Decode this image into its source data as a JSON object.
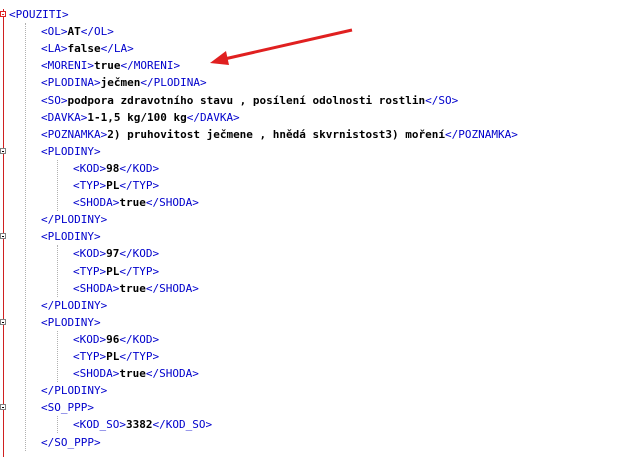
{
  "lines": [
    {
      "o": "<POUZITI>",
      "v": "",
      "c": ""
    },
    {
      "o": "<OL>",
      "v": "AT",
      "c": "</OL>"
    },
    {
      "o": "<LA>",
      "v": "false",
      "c": "</LA>"
    },
    {
      "o": "<MORENI>",
      "v": "true",
      "c": "</MORENI>"
    },
    {
      "o": "<PLODINA>",
      "v": "ječmen",
      "c": "</PLODINA>"
    },
    {
      "o": "<SO>",
      "v": "podpora zdravotního stavu , posílení odolnosti rostlin",
      "c": "</SO>"
    },
    {
      "o": "<DAVKA>",
      "v": "1-1,5 kg/100 kg",
      "c": "</DAVKA>"
    },
    {
      "o": "<POZNAMKA>",
      "v": "2) pruhovitost ječmene , hnědá skvrnistost3) moření",
      "c": "</POZNAMKA>"
    },
    {
      "o": "<PLODINY>",
      "v": "",
      "c": ""
    },
    {
      "o": "<KOD>",
      "v": "98",
      "c": "</KOD>"
    },
    {
      "o": "<TYP>",
      "v": "PL",
      "c": "</TYP>"
    },
    {
      "o": "<SHODA>",
      "v": "true",
      "c": "</SHODA>"
    },
    {
      "o": "</PLODINY>",
      "v": "",
      "c": ""
    },
    {
      "o": "<PLODINY>",
      "v": "",
      "c": ""
    },
    {
      "o": "<KOD>",
      "v": "97",
      "c": "</KOD>"
    },
    {
      "o": "<TYP>",
      "v": "PL",
      "c": "</TYP>"
    },
    {
      "o": "<SHODA>",
      "v": "true",
      "c": "</SHODA>"
    },
    {
      "o": "</PLODINY>",
      "v": "",
      "c": ""
    },
    {
      "o": "<PLODINY>",
      "v": "",
      "c": ""
    },
    {
      "o": "<KOD>",
      "v": "96",
      "c": "</KOD>"
    },
    {
      "o": "<TYP>",
      "v": "PL",
      "c": "</TYP>"
    },
    {
      "o": "<SHODA>",
      "v": "true",
      "c": "</SHODA>"
    },
    {
      "o": "</PLODINY>",
      "v": "",
      "c": ""
    },
    {
      "o": "<SO_PPP>",
      "v": "",
      "c": ""
    },
    {
      "o": "<KOD_SO>",
      "v": "3382",
      "c": "</KOD_SO>"
    },
    {
      "o": "</SO_PPP>",
      "v": "",
      "c": ""
    }
  ],
  "colors": {
    "tag": "#0000cc",
    "value": "#000000",
    "annotation_arrow": "#e02020",
    "fold_marker": "#e02020"
  }
}
